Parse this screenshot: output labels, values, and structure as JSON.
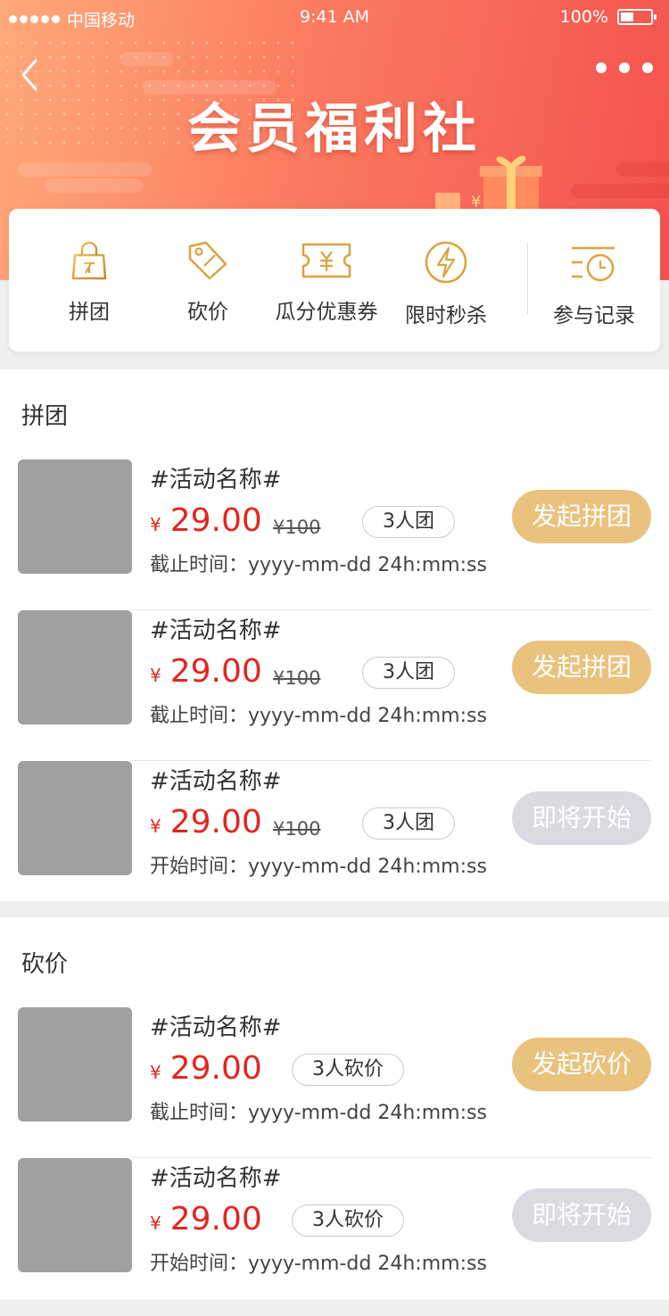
{
  "status_bar": {
    "carrier": "中国移动",
    "time": "9:41 AM",
    "battery": "100%"
  },
  "header": {
    "title": "会员福利社"
  },
  "menu": {
    "items": [
      {
        "label": "拼团",
        "icon": "shopping-bag-icon"
      },
      {
        "label": "砍价",
        "icon": "price-tag-icon"
      },
      {
        "label": "瓜分优惠券",
        "icon": "coupon-icon"
      },
      {
        "label": "限时秒杀",
        "icon": "flash-icon"
      },
      {
        "label": "参与记录",
        "icon": "record-clock-icon"
      }
    ]
  },
  "groupbuy": {
    "title": "拼团",
    "items": [
      {
        "name": "#活动名称#",
        "currency": "¥",
        "price": "29.00",
        "original": "¥100",
        "tag": "3人团",
        "date": "截止时间：yyyy-mm-dd 24h:mm:ss",
        "button": "发起拼团",
        "state": "active"
      },
      {
        "name": "#活动名称#",
        "currency": "¥",
        "price": "29.00",
        "original": "¥100",
        "tag": "3人团",
        "date": "截止时间：yyyy-mm-dd 24h:mm:ss",
        "button": "发起拼团",
        "state": "active"
      },
      {
        "name": "#活动名称#",
        "currency": "¥",
        "price": "29.00",
        "original": "¥100",
        "tag": "3人团",
        "date": "开始时间：yyyy-mm-dd 24h:mm:ss",
        "button": "即将开始",
        "state": "disabled"
      }
    ]
  },
  "bargain": {
    "title": "砍价",
    "items": [
      {
        "name": "#活动名称#",
        "currency": "¥",
        "price": "29.00",
        "tag": "3人砍价",
        "date": "截止时间：yyyy-mm-dd 24h:mm:ss",
        "button": "发起砍价",
        "state": "active"
      },
      {
        "name": "#活动名称#",
        "currency": "¥",
        "price": "29.00",
        "tag": "3人砍价",
        "date": "开始时间：yyyy-mm-dd 24h:mm:ss",
        "button": "即将开始",
        "state": "disabled"
      }
    ]
  },
  "colors": {
    "accent_red": "#e3261d",
    "button_gold": "#e9c27d",
    "button_disabled": "#d9dbe0",
    "icon_gold": "#d9a441"
  }
}
